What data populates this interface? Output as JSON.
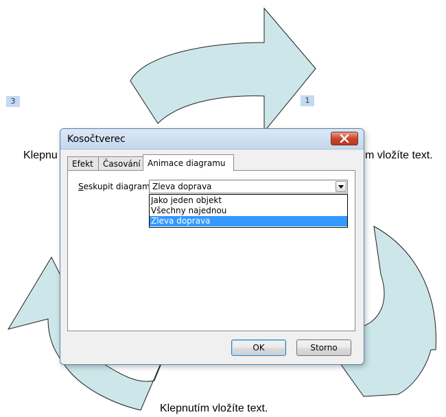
{
  "slide": {
    "text_top_left": "Klepnu",
    "text_top_right": "m vložíte text.",
    "text_bottom": "Klepnutím vložíte text.",
    "badge_left": "3",
    "badge_right": "1"
  },
  "colors": {
    "arrow_fill": "#cde6e9",
    "arrow_stroke": "#1f1f1f",
    "selection": "#3399ff"
  },
  "dialog": {
    "title": "Kosočtverec",
    "close_icon": "close-x-icon",
    "tabs": [
      {
        "label": "Efekt",
        "active": false
      },
      {
        "label": "Časování",
        "active": false
      },
      {
        "label": "Animace diagramu",
        "active": true
      }
    ],
    "group_label_prefix": "S",
    "group_label_rest": "eskupit diagram:",
    "select_value": "Zleva doprava",
    "options": [
      {
        "label": "Jako jeden objekt",
        "selected": false
      },
      {
        "label": "Všechny najednou",
        "selected": false
      },
      {
        "label": "Zleva doprava",
        "selected": true
      }
    ],
    "ok_label": "OK",
    "cancel_label": "Storno"
  }
}
